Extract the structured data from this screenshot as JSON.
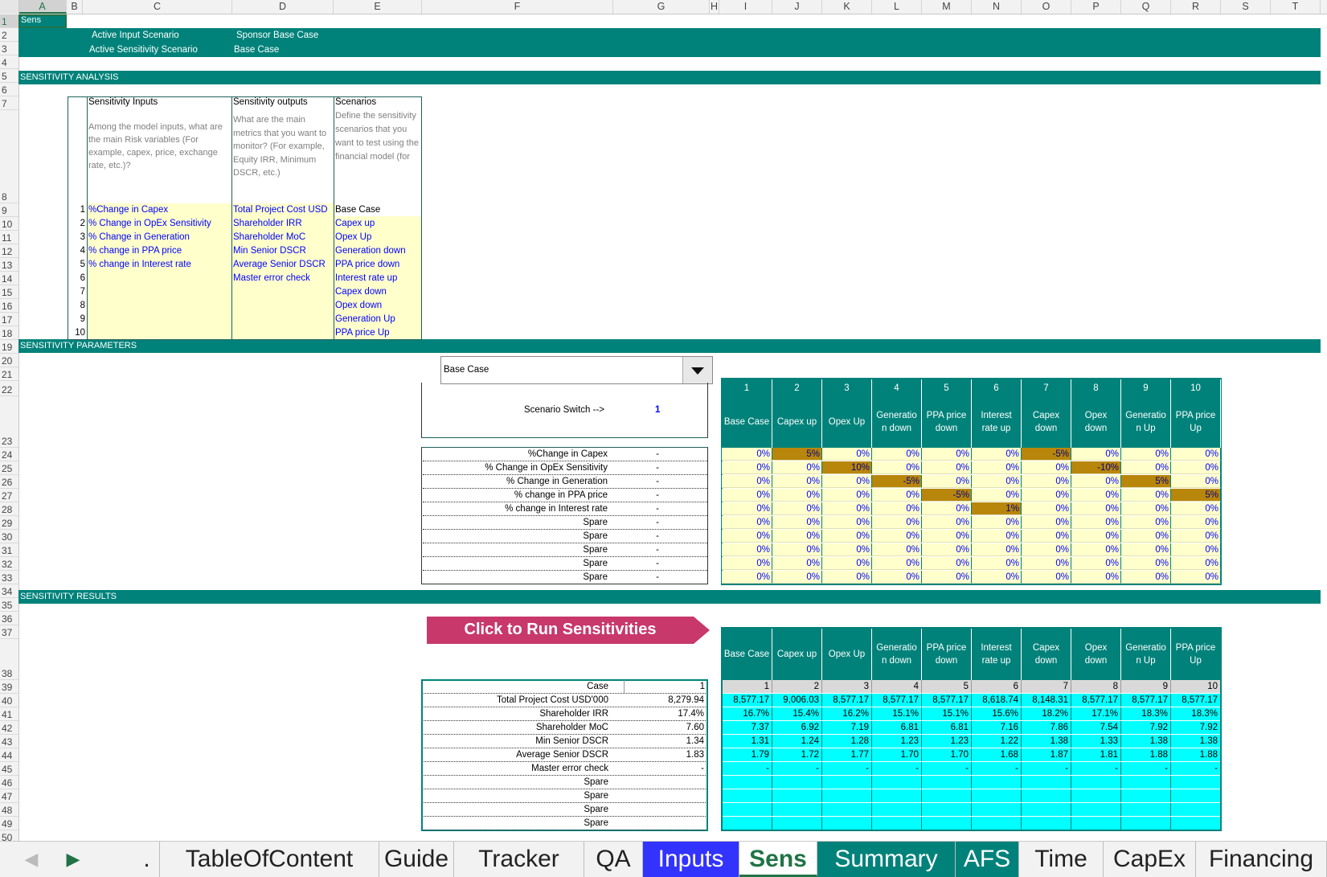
{
  "name_box": "Sens",
  "columns": [
    "A",
    "B",
    "C",
    "D",
    "E",
    "F",
    "G",
    "H",
    "I",
    "J",
    "K",
    "L",
    "M",
    "N",
    "O",
    "P",
    "Q",
    "R",
    "S",
    "T"
  ],
  "rows": [
    "1",
    "2",
    "3",
    "4",
    "5",
    "6",
    "7",
    "8",
    "9",
    "10",
    "11",
    "12",
    "13",
    "14",
    "15",
    "16",
    "17",
    "18",
    "19",
    "20",
    "21",
    "22",
    "23",
    "24",
    "25",
    "26",
    "27",
    "28",
    "29",
    "30",
    "31",
    "32",
    "33",
    "34",
    "35",
    "36",
    "37",
    "38",
    "39",
    "40",
    "41",
    "42",
    "43",
    "44",
    "45",
    "46",
    "47",
    "48",
    "49",
    "50"
  ],
  "header": {
    "active_input_label": "Active Input Scenario",
    "active_input_value": "Sponsor Base Case",
    "active_sens_label": "Active Sensitivity Scenario",
    "active_sens_value": "Base Case"
  },
  "sections": {
    "analysis": "SENSITIVITY ANALYSIS",
    "parameters": "SENSITIVITY PARAMETERS",
    "results": "SENSITIVITY RESULTS"
  },
  "analysis_table": {
    "inputs_title": "Sensitivity Inputs",
    "inputs_desc": "Among the model inputs, what are the main Risk variables (For example, capex, price, exchange rate, etc.)?",
    "outputs_title": "Sensitivity outputs",
    "outputs_desc": "What are the main metrics that you want to monitor? (For example, Equity IRR, Minimum DSCR, etc.)",
    "scen_title": "Scenarios",
    "scen_desc": "Define the sensitivity scenarios that you want to test using the financial model (for",
    "numbers": [
      "1",
      "2",
      "3",
      "4",
      "5",
      "6",
      "7",
      "8",
      "9",
      "10"
    ],
    "inputs": [
      "%Change in Capex",
      "% Change in OpEx Sensitivity",
      "% Change in Generation",
      "% change in PPA price",
      "% change in Interest rate",
      "",
      "",
      "",
      "",
      ""
    ],
    "outputs": [
      "Total Project Cost USD",
      "Shareholder IRR",
      "Shareholder MoC",
      "Min Senior DSCR",
      "Average Senior DSCR",
      "Master error check",
      "",
      "",
      "",
      ""
    ],
    "scenarios": [
      "Base Case",
      "Capex up",
      "Opex Up",
      "Generation down",
      "PPA price down",
      "Interest rate up",
      "Capex down",
      "Opex down",
      "Generation Up",
      "PPA price Up"
    ]
  },
  "dropdown": {
    "value": "Base Case"
  },
  "switch": {
    "label": "Scenario Switch -->",
    "value": "1"
  },
  "param_labels": [
    "%Change in Capex",
    "% Change in OpEx Sensitivity",
    "% Change in Generation",
    "% change in PPA price",
    "% change in Interest rate",
    "Spare",
    "Spare",
    "Spare",
    "Spare",
    "Spare"
  ],
  "param_values": [
    "-",
    "-",
    "-",
    "-",
    "-",
    "-",
    "-",
    "-",
    "-",
    "-"
  ],
  "scenario_numbers": [
    "1",
    "2",
    "3",
    "4",
    "5",
    "6",
    "7",
    "8",
    "9",
    "10"
  ],
  "scenario_headers": [
    "Base Case",
    "Capex up",
    "Opex Up",
    "Generatio n down",
    "PPA price down",
    "Interest rate up",
    "Capex down",
    "Opex down",
    "Generatio n Up",
    "PPA price Up"
  ],
  "param_grid": [
    [
      "0%",
      "5%",
      "0%",
      "0%",
      "0%",
      "0%",
      "-5%",
      "0%",
      "0%",
      "0%"
    ],
    [
      "0%",
      "0%",
      "10%",
      "0%",
      "0%",
      "0%",
      "0%",
      "-10%",
      "0%",
      "0%"
    ],
    [
      "0%",
      "0%",
      "0%",
      "-5%",
      "0%",
      "0%",
      "0%",
      "0%",
      "5%",
      "0%"
    ],
    [
      "0%",
      "0%",
      "0%",
      "0%",
      "-5%",
      "0%",
      "0%",
      "0%",
      "0%",
      "5%"
    ],
    [
      "0%",
      "0%",
      "0%",
      "0%",
      "0%",
      "1%",
      "0%",
      "0%",
      "0%",
      "0%"
    ],
    [
      "0%",
      "0%",
      "0%",
      "0%",
      "0%",
      "0%",
      "0%",
      "0%",
      "0%",
      "0%"
    ],
    [
      "0%",
      "0%",
      "0%",
      "0%",
      "0%",
      "0%",
      "0%",
      "0%",
      "0%",
      "0%"
    ],
    [
      "0%",
      "0%",
      "0%",
      "0%",
      "0%",
      "0%",
      "0%",
      "0%",
      "0%",
      "0%"
    ],
    [
      "0%",
      "0%",
      "0%",
      "0%",
      "0%",
      "0%",
      "0%",
      "0%",
      "0%",
      "0%"
    ],
    [
      "0%",
      "0%",
      "0%",
      "0%",
      "0%",
      "0%",
      "0%",
      "0%",
      "0%",
      "0%"
    ]
  ],
  "run_button": "Click to Run Sensitivities",
  "result_labels": [
    "Case",
    "Total Project Cost USD'000",
    "Shareholder IRR",
    "Shareholder MoC",
    "Min Senior DSCR",
    "Average Senior DSCR",
    "Master error check",
    "Spare",
    "Spare",
    "Spare",
    "Spare"
  ],
  "result_current": [
    "1",
    "8,279.94",
    "17.4%",
    "7.60",
    "1.34",
    "1.83",
    "-",
    "",
    "",
    "",
    ""
  ],
  "result_grid": [
    [
      "1",
      "2",
      "3",
      "4",
      "5",
      "6",
      "7",
      "8",
      "9",
      "10"
    ],
    [
      "8,577.17",
      "9,006.03",
      "8,577.17",
      "8,577.17",
      "8,577.17",
      "8,618.74",
      "8,148.31",
      "8,577.17",
      "8,577.17",
      "8,577.17"
    ],
    [
      "16.7%",
      "15.4%",
      "16.2%",
      "15.1%",
      "15.1%",
      "15.6%",
      "18.2%",
      "17.1%",
      "18.3%",
      "18.3%"
    ],
    [
      "7.37",
      "6.92",
      "7.19",
      "6.81",
      "6.81",
      "7.16",
      "7.86",
      "7.54",
      "7.92",
      "7.92"
    ],
    [
      "1.31",
      "1.24",
      "1.28",
      "1.23",
      "1.23",
      "1.22",
      "1.38",
      "1.33",
      "1.38",
      "1.38"
    ],
    [
      "1.79",
      "1.72",
      "1.77",
      "1.70",
      "1.70",
      "1.68",
      "1.87",
      "1.81",
      "1.88",
      "1.88"
    ],
    [
      "-",
      "-",
      "-",
      "-",
      "-",
      "-",
      "-",
      "-",
      "-",
      "-"
    ],
    [
      "",
      "",
      "",
      "",
      "",
      "",
      "",
      "",
      "",
      ""
    ],
    [
      "",
      "",
      "",
      "",
      "",
      "",
      "",
      "",
      "",
      ""
    ],
    [
      "",
      "",
      "",
      "",
      "",
      "",
      "",
      "",
      "",
      ""
    ],
    [
      "",
      "",
      "",
      "",
      "",
      "",
      "",
      "",
      "",
      ""
    ]
  ],
  "tabs": [
    ".",
    "TableOfContent",
    "Guide",
    "Tracker",
    "QA",
    "Inputs",
    "Sens",
    "Summary",
    "AFS",
    "Time",
    "CapEx",
    "Financing"
  ],
  "active_tab": "Sens",
  "colors": {
    "teal": "#00827a",
    "cream": "#ffffcc",
    "highlight": "#b8860b",
    "cyan": "#00ffff",
    "inputs_tab": "#3333ff",
    "run_button": "#c8386b"
  }
}
